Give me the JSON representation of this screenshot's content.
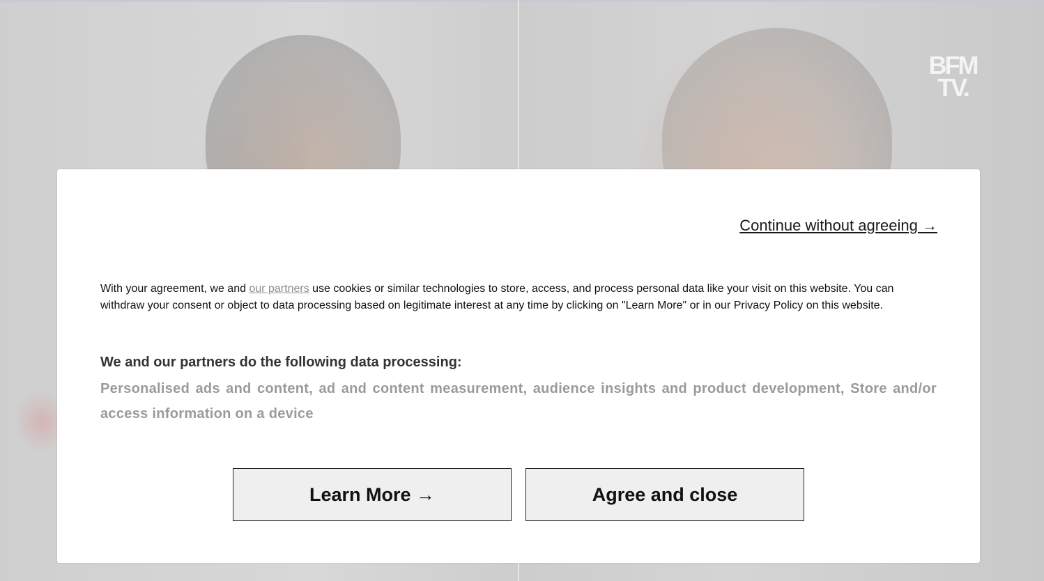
{
  "logo": {
    "line1": "BFM",
    "line2": "TV."
  },
  "dialog": {
    "continue_label": "Continue without agreeing →",
    "desc_before": "With your agreement, we and ",
    "desc_link": "our partners",
    "desc_after": " use cookies or similar technologies to store, access, and process personal data like your visit on this website. You can withdraw your consent or object to data processing based on legitimate interest at any time by clicking on \"Learn More\" or in our Privacy Policy on this website.",
    "purposes_heading": "We and our partners do the following data processing:",
    "purposes_list": "Personalised ads and content, ad and content measurement, audience insights and product development, Store and/or access information on a device",
    "learn_more_label": "Learn More →",
    "agree_label": "Agree and close"
  }
}
